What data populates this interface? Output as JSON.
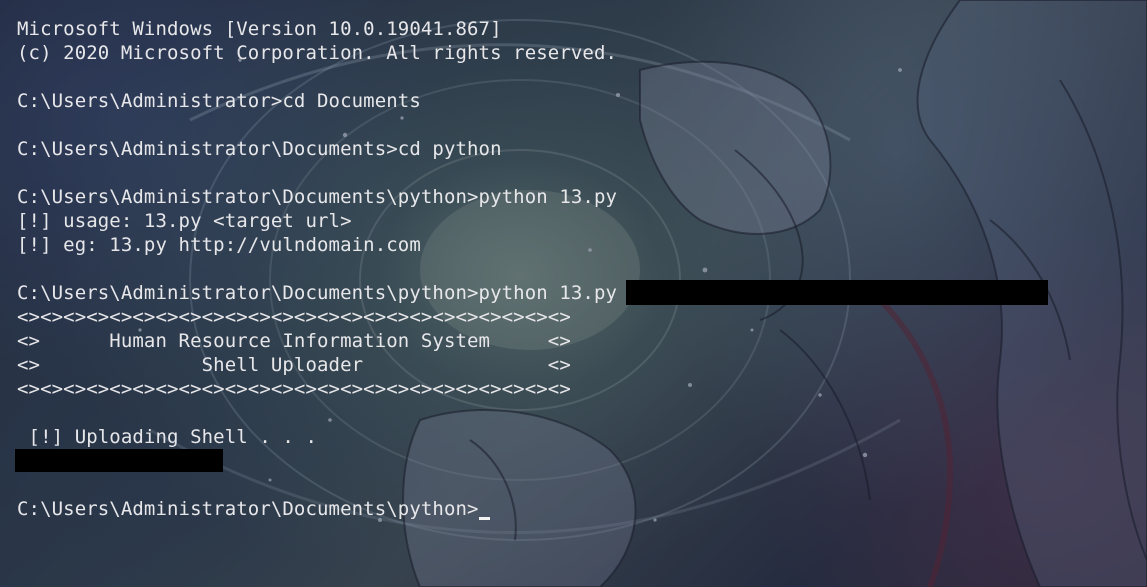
{
  "terminal": {
    "header": {
      "version_line": "Microsoft Windows [Version 10.0.19041.867]",
      "copyright_line": "(c) 2020 Microsoft Corporation. All rights reserved."
    },
    "session": {
      "cmd_1": "C:\\Users\\Administrator>cd Documents",
      "cmd_2": "C:\\Users\\Administrator\\Documents>cd python",
      "cmd_3": "C:\\Users\\Administrator\\Documents\\python>python 13.py",
      "usage_line": "[!] usage: 13.py <target url>",
      "example_line": "[!] eg: 13.py http://vulndomain.com",
      "cmd_4": "C:\\Users\\Administrator\\Documents\\python>python 13.py",
      "banner_border_top": "<><><><><><><><><><><><><><><><><><><><><><><><>",
      "banner_line_1": "<>      Human Resource Information System     <>",
      "banner_line_2": "<>              Shell Uploader                <>",
      "banner_border_bottom": "<><><><><><><><><><><><><><><><><><><><><><><><>",
      "uploading_line": " [!] Uploading Shell . . .",
      "prompt": "C:\\Users\\Administrator\\Documents\\python>"
    }
  },
  "colors": {
    "text": "#e7e7ea",
    "redaction": "#000000",
    "cursor": "#f2f2f2"
  }
}
